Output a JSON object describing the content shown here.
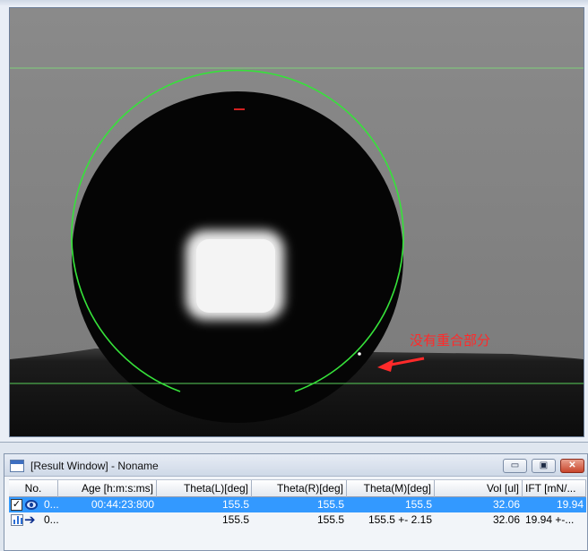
{
  "image_window": {
    "title_fragment": "",
    "annotation_text": "没有重合部分"
  },
  "result_window": {
    "title": "[Result Window] - Noname",
    "controls": {
      "minimize": "▭",
      "maximize": "▣",
      "close": "✕"
    },
    "columns": [
      "No.",
      "Age [h:m:s:ms]",
      "Theta(L)[deg]",
      "Theta(R)[deg]",
      "Theta(M)[deg]",
      "Vol [ul]",
      "IFT [mN/..."
    ],
    "rows": [
      {
        "no": "0...",
        "age": "00:44:23:800",
        "theta_l": "155.5",
        "theta_r": "155.5",
        "theta_m": "155.5",
        "vol": "32.06",
        "ift": "19.94",
        "selected": true,
        "checked": "✓"
      },
      {
        "no": "0...",
        "age": "",
        "theta_l": "155.5",
        "theta_r": "155.5",
        "theta_m": "155.5 +- 2.15",
        "vol": "32.06",
        "ift": "19.94 +-...",
        "selected": false,
        "checked": ""
      }
    ]
  },
  "colors": {
    "fit_line": "#36e23a",
    "annotation": "#ff2a2a",
    "selection": "#3399ff"
  }
}
